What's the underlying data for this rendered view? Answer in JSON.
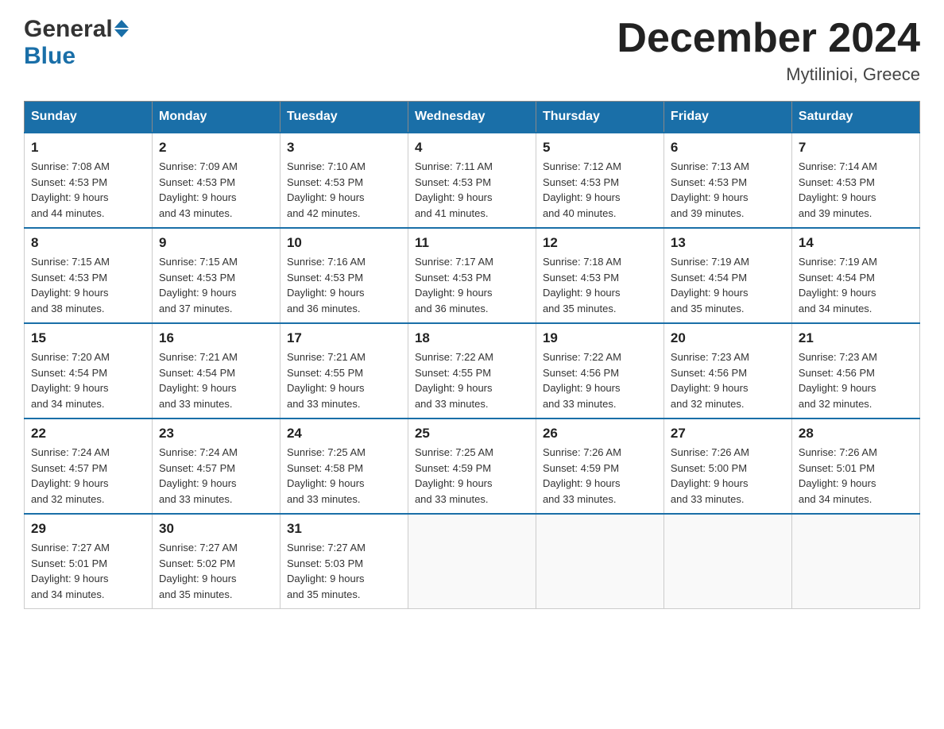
{
  "header": {
    "month_title": "December 2024",
    "location": "Mytilinioi, Greece"
  },
  "logo": {
    "general": "General",
    "blue": "Blue"
  },
  "days_of_week": [
    "Sunday",
    "Monday",
    "Tuesday",
    "Wednesday",
    "Thursday",
    "Friday",
    "Saturday"
  ],
  "weeks": [
    {
      "days": [
        {
          "number": "1",
          "sunrise": "7:08 AM",
          "sunset": "4:53 PM",
          "daylight": "9 hours and 44 minutes."
        },
        {
          "number": "2",
          "sunrise": "7:09 AM",
          "sunset": "4:53 PM",
          "daylight": "9 hours and 43 minutes."
        },
        {
          "number": "3",
          "sunrise": "7:10 AM",
          "sunset": "4:53 PM",
          "daylight": "9 hours and 42 minutes."
        },
        {
          "number": "4",
          "sunrise": "7:11 AM",
          "sunset": "4:53 PM",
          "daylight": "9 hours and 41 minutes."
        },
        {
          "number": "5",
          "sunrise": "7:12 AM",
          "sunset": "4:53 PM",
          "daylight": "9 hours and 40 minutes."
        },
        {
          "number": "6",
          "sunrise": "7:13 AM",
          "sunset": "4:53 PM",
          "daylight": "9 hours and 39 minutes."
        },
        {
          "number": "7",
          "sunrise": "7:14 AM",
          "sunset": "4:53 PM",
          "daylight": "9 hours and 39 minutes."
        }
      ]
    },
    {
      "days": [
        {
          "number": "8",
          "sunrise": "7:15 AM",
          "sunset": "4:53 PM",
          "daylight": "9 hours and 38 minutes."
        },
        {
          "number": "9",
          "sunrise": "7:15 AM",
          "sunset": "4:53 PM",
          "daylight": "9 hours and 37 minutes."
        },
        {
          "number": "10",
          "sunrise": "7:16 AM",
          "sunset": "4:53 PM",
          "daylight": "9 hours and 36 minutes."
        },
        {
          "number": "11",
          "sunrise": "7:17 AM",
          "sunset": "4:53 PM",
          "daylight": "9 hours and 36 minutes."
        },
        {
          "number": "12",
          "sunrise": "7:18 AM",
          "sunset": "4:53 PM",
          "daylight": "9 hours and 35 minutes."
        },
        {
          "number": "13",
          "sunrise": "7:19 AM",
          "sunset": "4:54 PM",
          "daylight": "9 hours and 35 minutes."
        },
        {
          "number": "14",
          "sunrise": "7:19 AM",
          "sunset": "4:54 PM",
          "daylight": "9 hours and 34 minutes."
        }
      ]
    },
    {
      "days": [
        {
          "number": "15",
          "sunrise": "7:20 AM",
          "sunset": "4:54 PM",
          "daylight": "9 hours and 34 minutes."
        },
        {
          "number": "16",
          "sunrise": "7:21 AM",
          "sunset": "4:54 PM",
          "daylight": "9 hours and 33 minutes."
        },
        {
          "number": "17",
          "sunrise": "7:21 AM",
          "sunset": "4:55 PM",
          "daylight": "9 hours and 33 minutes."
        },
        {
          "number": "18",
          "sunrise": "7:22 AM",
          "sunset": "4:55 PM",
          "daylight": "9 hours and 33 minutes."
        },
        {
          "number": "19",
          "sunrise": "7:22 AM",
          "sunset": "4:56 PM",
          "daylight": "9 hours and 33 minutes."
        },
        {
          "number": "20",
          "sunrise": "7:23 AM",
          "sunset": "4:56 PM",
          "daylight": "9 hours and 32 minutes."
        },
        {
          "number": "21",
          "sunrise": "7:23 AM",
          "sunset": "4:56 PM",
          "daylight": "9 hours and 32 minutes."
        }
      ]
    },
    {
      "days": [
        {
          "number": "22",
          "sunrise": "7:24 AM",
          "sunset": "4:57 PM",
          "daylight": "9 hours and 32 minutes."
        },
        {
          "number": "23",
          "sunrise": "7:24 AM",
          "sunset": "4:57 PM",
          "daylight": "9 hours and 33 minutes."
        },
        {
          "number": "24",
          "sunrise": "7:25 AM",
          "sunset": "4:58 PM",
          "daylight": "9 hours and 33 minutes."
        },
        {
          "number": "25",
          "sunrise": "7:25 AM",
          "sunset": "4:59 PM",
          "daylight": "9 hours and 33 minutes."
        },
        {
          "number": "26",
          "sunrise": "7:26 AM",
          "sunset": "4:59 PM",
          "daylight": "9 hours and 33 minutes."
        },
        {
          "number": "27",
          "sunrise": "7:26 AM",
          "sunset": "5:00 PM",
          "daylight": "9 hours and 33 minutes."
        },
        {
          "number": "28",
          "sunrise": "7:26 AM",
          "sunset": "5:01 PM",
          "daylight": "9 hours and 34 minutes."
        }
      ]
    },
    {
      "days": [
        {
          "number": "29",
          "sunrise": "7:27 AM",
          "sunset": "5:01 PM",
          "daylight": "9 hours and 34 minutes."
        },
        {
          "number": "30",
          "sunrise": "7:27 AM",
          "sunset": "5:02 PM",
          "daylight": "9 hours and 35 minutes."
        },
        {
          "number": "31",
          "sunrise": "7:27 AM",
          "sunset": "5:03 PM",
          "daylight": "9 hours and 35 minutes."
        },
        null,
        null,
        null,
        null
      ]
    }
  ],
  "labels": {
    "sunrise_prefix": "Sunrise: ",
    "sunset_prefix": "Sunset: ",
    "daylight_prefix": "Daylight: "
  }
}
